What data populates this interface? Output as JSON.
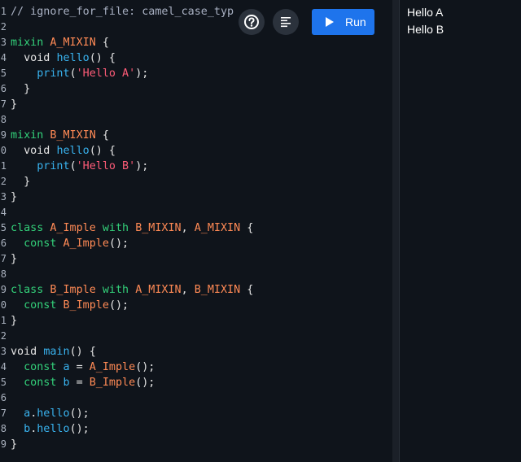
{
  "toolbar": {
    "help_icon": "help-circle-icon",
    "format_icon": "format-align-icon",
    "run_label": "Run",
    "run_icon": "play-icon",
    "accent": "#1e74ec"
  },
  "editor": {
    "line_numbers": [
      "1",
      "2",
      "3",
      "4",
      "5",
      "6",
      "7",
      "8",
      "9",
      "0",
      "1",
      "2",
      "3",
      "4",
      "5",
      "6",
      "7",
      "8",
      "9",
      "0",
      "1",
      "2",
      "3",
      "4",
      "5",
      "6",
      "7",
      "8",
      "9"
    ],
    "lines": [
      [
        [
          "comment",
          "// ignore_for_file: camel_case_typ"
        ]
      ],
      [],
      [
        [
          "kw",
          "mixin"
        ],
        [
          "plain",
          " "
        ],
        [
          "name",
          "A_MIXIN"
        ],
        [
          "plain",
          " {"
        ]
      ],
      [
        [
          "plain",
          "  void "
        ],
        [
          "fn",
          "hello"
        ],
        [
          "plain",
          "() {"
        ]
      ],
      [
        [
          "plain",
          "    "
        ],
        [
          "fn",
          "print"
        ],
        [
          "plain",
          "("
        ],
        [
          "str",
          "'Hello A'"
        ],
        [
          "plain",
          ");"
        ]
      ],
      [
        [
          "plain",
          "  }"
        ]
      ],
      [
        [
          "plain",
          "}"
        ]
      ],
      [],
      [
        [
          "kw",
          "mixin"
        ],
        [
          "plain",
          " "
        ],
        [
          "name",
          "B_MIXIN"
        ],
        [
          "plain",
          " {"
        ]
      ],
      [
        [
          "plain",
          "  void "
        ],
        [
          "fn",
          "hello"
        ],
        [
          "plain",
          "() {"
        ]
      ],
      [
        [
          "plain",
          "    "
        ],
        [
          "fn",
          "print"
        ],
        [
          "plain",
          "("
        ],
        [
          "str",
          "'Hello B'"
        ],
        [
          "plain",
          ");"
        ]
      ],
      [
        [
          "plain",
          "  }"
        ]
      ],
      [
        [
          "plain",
          "}"
        ]
      ],
      [],
      [
        [
          "kw",
          "class"
        ],
        [
          "plain",
          " "
        ],
        [
          "name",
          "A_Imple"
        ],
        [
          "plain",
          " "
        ],
        [
          "kw",
          "with"
        ],
        [
          "plain",
          " "
        ],
        [
          "name",
          "B_MIXIN"
        ],
        [
          "plain",
          ", "
        ],
        [
          "name",
          "A_MIXIN"
        ],
        [
          "plain",
          " {"
        ]
      ],
      [
        [
          "plain",
          "  "
        ],
        [
          "kw",
          "const"
        ],
        [
          "plain",
          " "
        ],
        [
          "name",
          "A_Imple"
        ],
        [
          "plain",
          "();"
        ]
      ],
      [
        [
          "plain",
          "}"
        ]
      ],
      [],
      [
        [
          "kw",
          "class"
        ],
        [
          "plain",
          " "
        ],
        [
          "name",
          "B_Imple"
        ],
        [
          "plain",
          " "
        ],
        [
          "kw",
          "with"
        ],
        [
          "plain",
          " "
        ],
        [
          "name",
          "A_MIXIN"
        ],
        [
          "plain",
          ", "
        ],
        [
          "name",
          "B_MIXIN"
        ],
        [
          "plain",
          " {"
        ]
      ],
      [
        [
          "plain",
          "  "
        ],
        [
          "kw",
          "const"
        ],
        [
          "plain",
          " "
        ],
        [
          "name",
          "B_Imple"
        ],
        [
          "plain",
          "();"
        ]
      ],
      [
        [
          "plain",
          "}"
        ]
      ],
      [],
      [
        [
          "plain",
          "void "
        ],
        [
          "fn",
          "main"
        ],
        [
          "plain",
          "() {"
        ]
      ],
      [
        [
          "plain",
          "  "
        ],
        [
          "kw",
          "const"
        ],
        [
          "plain",
          " "
        ],
        [
          "fn",
          "a"
        ],
        [
          "plain",
          " = "
        ],
        [
          "name",
          "A_Imple"
        ],
        [
          "plain",
          "();"
        ]
      ],
      [
        [
          "plain",
          "  "
        ],
        [
          "kw",
          "const"
        ],
        [
          "plain",
          " "
        ],
        [
          "fn",
          "b"
        ],
        [
          "plain",
          " = "
        ],
        [
          "name",
          "B_Imple"
        ],
        [
          "plain",
          "();"
        ]
      ],
      [],
      [
        [
          "plain",
          "  "
        ],
        [
          "fn",
          "a"
        ],
        [
          "plain",
          "."
        ],
        [
          "fn",
          "hello"
        ],
        [
          "plain",
          "();"
        ]
      ],
      [
        [
          "plain",
          "  "
        ],
        [
          "fn",
          "b"
        ],
        [
          "plain",
          "."
        ],
        [
          "fn",
          "hello"
        ],
        [
          "plain",
          "();"
        ]
      ],
      [
        [
          "plain",
          "}"
        ]
      ]
    ]
  },
  "output": {
    "lines": [
      "Hello A",
      "Hello B"
    ]
  }
}
